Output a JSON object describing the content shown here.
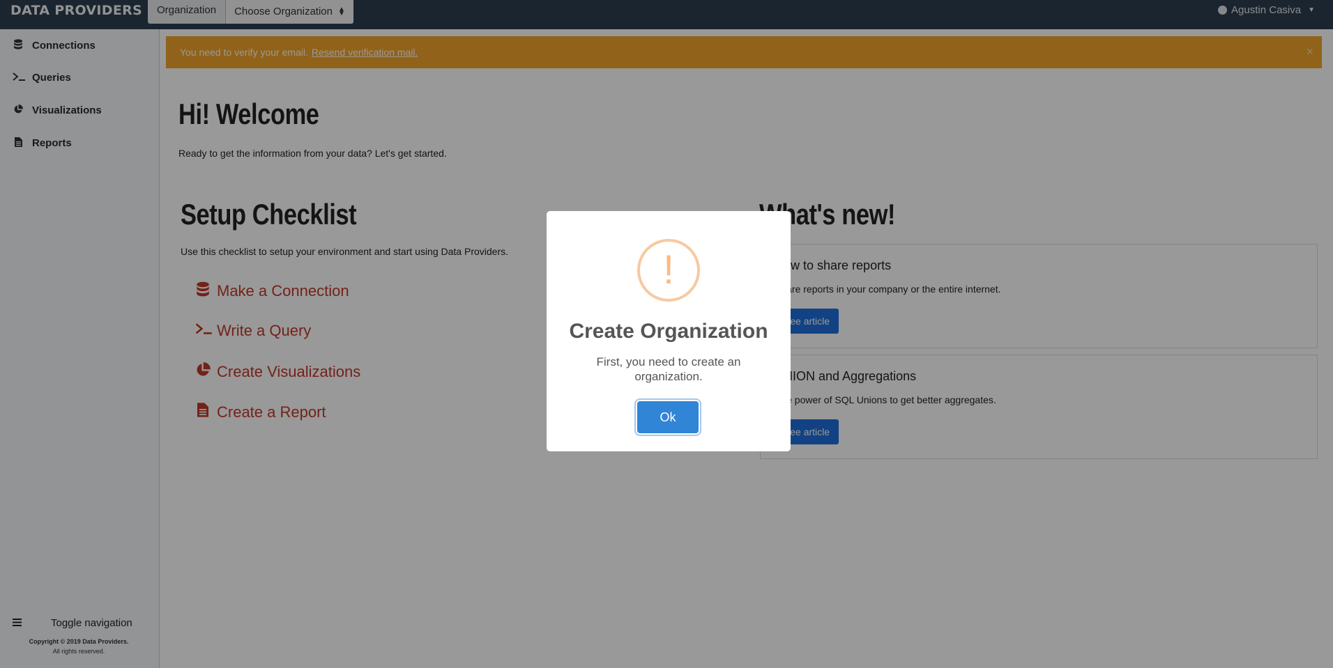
{
  "topbar": {
    "brand": "DATA PROVIDERS",
    "org_label": "Organization",
    "org_select": "Choose Organization",
    "user_name": "Agustin Casiva"
  },
  "sidebar": {
    "items": [
      {
        "label": "Connections",
        "icon": "database-icon"
      },
      {
        "label": "Queries",
        "icon": "terminal-icon"
      },
      {
        "label": "Visualizations",
        "icon": "pie-chart-icon"
      },
      {
        "label": "Reports",
        "icon": "document-icon"
      }
    ],
    "toggle_label": "Toggle navigation",
    "copyright_line1": "Copyright © 2019 Data Providers.",
    "copyright_line2": "All rights reserved."
  },
  "alert": {
    "text": "You need to verify your email.",
    "link": "Resend verification mail.",
    "close": "×"
  },
  "welcome": {
    "title": "Hi! Welcome",
    "subtitle": "Ready to get the information from your data? Let's get started."
  },
  "setup": {
    "title": "Setup Checklist",
    "subtitle": "Use this checklist to setup your environment and start using Data Providers.",
    "items": [
      {
        "label": "Make a Connection",
        "icon": "database-icon"
      },
      {
        "label": "Write a Query",
        "icon": "terminal-icon"
      },
      {
        "label": "Create Visualizations",
        "icon": "pie-chart-icon"
      },
      {
        "label": "Create a Report",
        "icon": "document-icon"
      }
    ]
  },
  "news": {
    "title": "What's new!",
    "cards": [
      {
        "title": "How to share reports",
        "desc": "Share reports in your company or the entire internet.",
        "button": "See article"
      },
      {
        "title": "UNION and Aggregations",
        "desc": "Use power of SQL Unions to get better aggregates.",
        "button": "See article"
      }
    ]
  },
  "modal": {
    "icon": "!",
    "title": "Create Organization",
    "text": "First, you need to create an organization.",
    "ok": "Ok"
  },
  "colors": {
    "topbar": "#2c3e50",
    "alert": "#f2a32a",
    "checklist": "#c0392b",
    "card_button": "#1f6fdb",
    "ok_button": "#3085d6"
  }
}
